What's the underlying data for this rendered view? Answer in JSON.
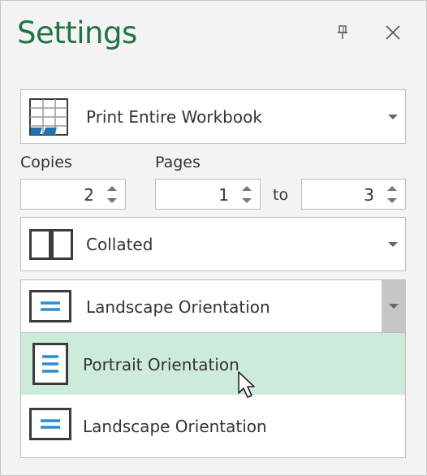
{
  "header": {
    "title": "Settings",
    "pin_icon": "pin-icon",
    "close_icon": "close-icon"
  },
  "print_what": {
    "label": "Print Entire Workbook",
    "icon": "workbook-grid-icon"
  },
  "copies": {
    "label": "Copies",
    "value": "2"
  },
  "pages": {
    "label": "Pages",
    "from": "1",
    "to_label": "to",
    "to": "3"
  },
  "collation": {
    "label": "Collated",
    "icon": "collated-pages-icon"
  },
  "orientation": {
    "selected": "Landscape Orientation",
    "options": [
      {
        "label": "Portrait Orientation",
        "icon": "portrait-orientation-icon",
        "hovered": true
      },
      {
        "label": "Landscape Orientation",
        "icon": "landscape-orientation-icon",
        "hovered": false
      }
    ]
  },
  "colors": {
    "accent": "#217346",
    "icon_blue": "#2a8dd4",
    "hover_bg": "#cdebdb",
    "dark_icon": "#3b3b3b"
  }
}
